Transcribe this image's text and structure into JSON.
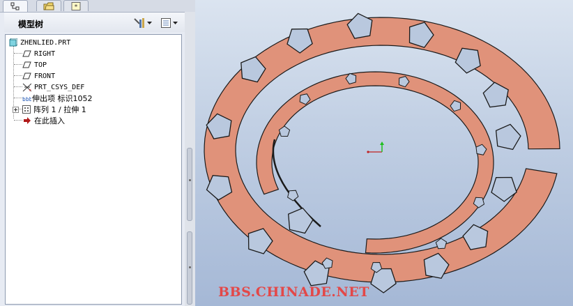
{
  "tabs": [
    {
      "name": "model-tree",
      "icon": "model-tree-icon"
    },
    {
      "name": "folder-browser",
      "icon": "folder-icon"
    },
    {
      "name": "favorites",
      "icon": "star-icon"
    }
  ],
  "panel": {
    "title": "模型树",
    "tools_icon": "settings-tools-icon",
    "show_icon": "tree-filter-icon"
  },
  "tree": {
    "root": "ZHENLIED.PRT",
    "items": [
      {
        "label": "RIGHT",
        "icon": "datum-plane-icon"
      },
      {
        "label": "TOP",
        "icon": "datum-plane-icon"
      },
      {
        "label": "FRONT",
        "icon": "datum-plane-icon"
      },
      {
        "label": "PRT_CSYS_DEF",
        "icon": "coordinate-system-icon"
      },
      {
        "label": "伸出项 标识1052",
        "icon": "protrusion-icon"
      },
      {
        "label": "阵列 1 / 拉伸 1",
        "icon": "pattern-icon"
      },
      {
        "label": "在此插入",
        "icon": "insert-here-arrow-icon"
      }
    ]
  },
  "watermark": "BBS.CHINADE.NET",
  "colors": {
    "part_fill": "#e0927a",
    "part_edge": "#1a1a1a",
    "viewport_top": "#dbe4f0",
    "viewport_bottom": "#a5b8d6",
    "watermark": "#e34848"
  }
}
